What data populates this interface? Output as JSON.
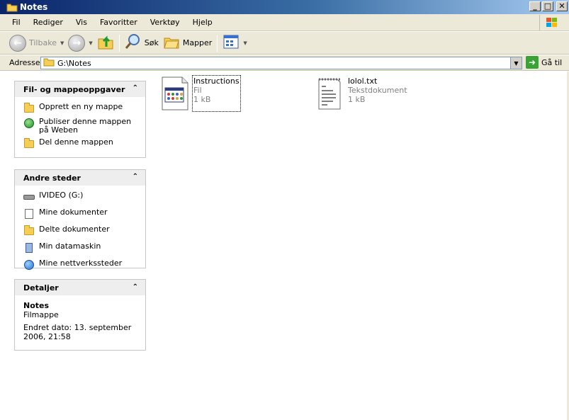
{
  "window": {
    "title": "Notes"
  },
  "menu": [
    "Fil",
    "Rediger",
    "Vis",
    "Favoritter",
    "Verktøy",
    "Hjelp"
  ],
  "toolbar": {
    "back": "Tilbake",
    "search": "Søk",
    "folders": "Mapper"
  },
  "address": {
    "label": "Adresse",
    "value": "G:\\Notes",
    "go": "Gå til"
  },
  "panes": {
    "tasks": {
      "title": "Fil- og mappeoppgaver",
      "items": [
        {
          "label": "Opprett en ny mappe",
          "icon": "new-folder-icon"
        },
        {
          "label": "Publiser denne mappen på Weben",
          "icon": "publish-web-icon"
        },
        {
          "label": "Del denne mappen",
          "icon": "share-folder-icon"
        }
      ]
    },
    "places": {
      "title": "Andre steder",
      "items": [
        {
          "label": "IVIDEO (G:)",
          "icon": "drive-icon"
        },
        {
          "label": "Mine dokumenter",
          "icon": "my-documents-icon"
        },
        {
          "label": "Delte dokumenter",
          "icon": "shared-documents-icon"
        },
        {
          "label": "Min datamaskin",
          "icon": "my-computer-icon"
        },
        {
          "label": "Mine nettverkssteder",
          "icon": "network-places-icon"
        }
      ]
    },
    "details": {
      "title": "Detaljer",
      "name": "Notes",
      "type": "Filmappe",
      "modified": "Endret dato: 13. september 2006, 21:58"
    }
  },
  "files": [
    {
      "name": "Instructions",
      "type": "Fil",
      "size": "1 kB",
      "icon": "application-file-icon",
      "selected": true
    },
    {
      "name": "lolol.txt",
      "type": "Tekstdokument",
      "size": "1 kB",
      "icon": "text-document-icon",
      "selected": false
    }
  ],
  "colors": {
    "titlebar": "#0a246a",
    "chrome": "#ece9d8",
    "pane_header": "#eeeeee"
  }
}
